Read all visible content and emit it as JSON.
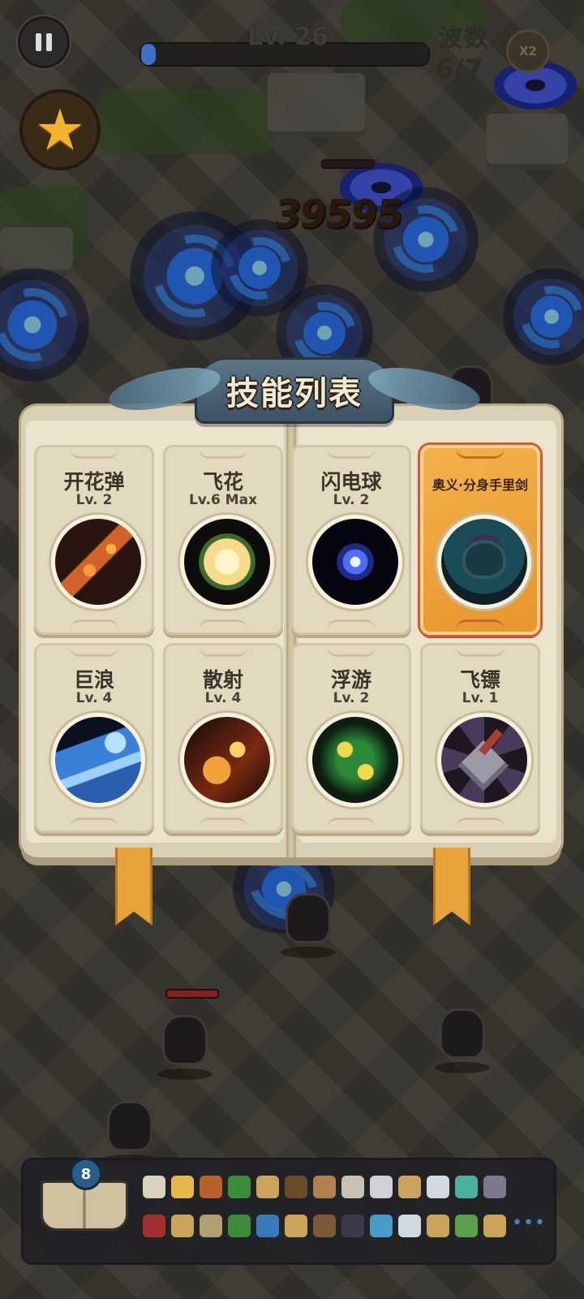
{
  "hud": {
    "level_label": "Lv. 26",
    "xp_progress": 0.05,
    "wave_title": "波数",
    "wave_count": "6/7",
    "speed_label": "X2"
  },
  "battle": {
    "damage_number": "39595"
  },
  "skill_book": {
    "title": "技能列表",
    "skills": [
      {
        "name": "开花弹",
        "level": "Lv. 2",
        "icon": "bloom-bullet-icon"
      },
      {
        "name": "飞花",
        "level": "Lv.6 Max",
        "icon": "flying-flower-icon"
      },
      {
        "name": "闪电球",
        "level": "Lv. 2",
        "icon": "lightning-ball-icon"
      },
      {
        "name": "奥义·分身手里剑",
        "level": "",
        "icon": "clone-shuriken-icon",
        "special": true
      },
      {
        "name": "巨浪",
        "level": "Lv. 4",
        "icon": "giant-wave-icon"
      },
      {
        "name": "散射",
        "level": "Lv. 4",
        "icon": "scatter-shot-icon"
      },
      {
        "name": "浮游",
        "level": "Lv. 2",
        "icon": "floating-orb-icon"
      },
      {
        "name": "飞镖",
        "level": "Lv. 1",
        "icon": "dart-icon"
      }
    ]
  },
  "inventory": {
    "book_badge": "8",
    "more_label": "•••",
    "items_row1": [
      "#d9d2c0",
      "#e6b84a",
      "#b8612a",
      "#3c8c3c",
      "#c9a45a",
      "#6a4a2a",
      "#b08050",
      "#c8c0b0",
      "#d0d0d8",
      "#c9a45a",
      "#d0d8e0",
      "#4ab0a0",
      "#7a7a8a"
    ],
    "items_row2": [
      "#a03030",
      "#c9a45a",
      "#b0a070",
      "#3c8c3c",
      "#3a7ab8",
      "#c9a45a",
      "#7a5a3a",
      "#3a3a4a",
      "#4a9ac8",
      "#d0d8e0",
      "#c9a45a",
      "#5aa04a",
      "#c9a45a"
    ]
  }
}
